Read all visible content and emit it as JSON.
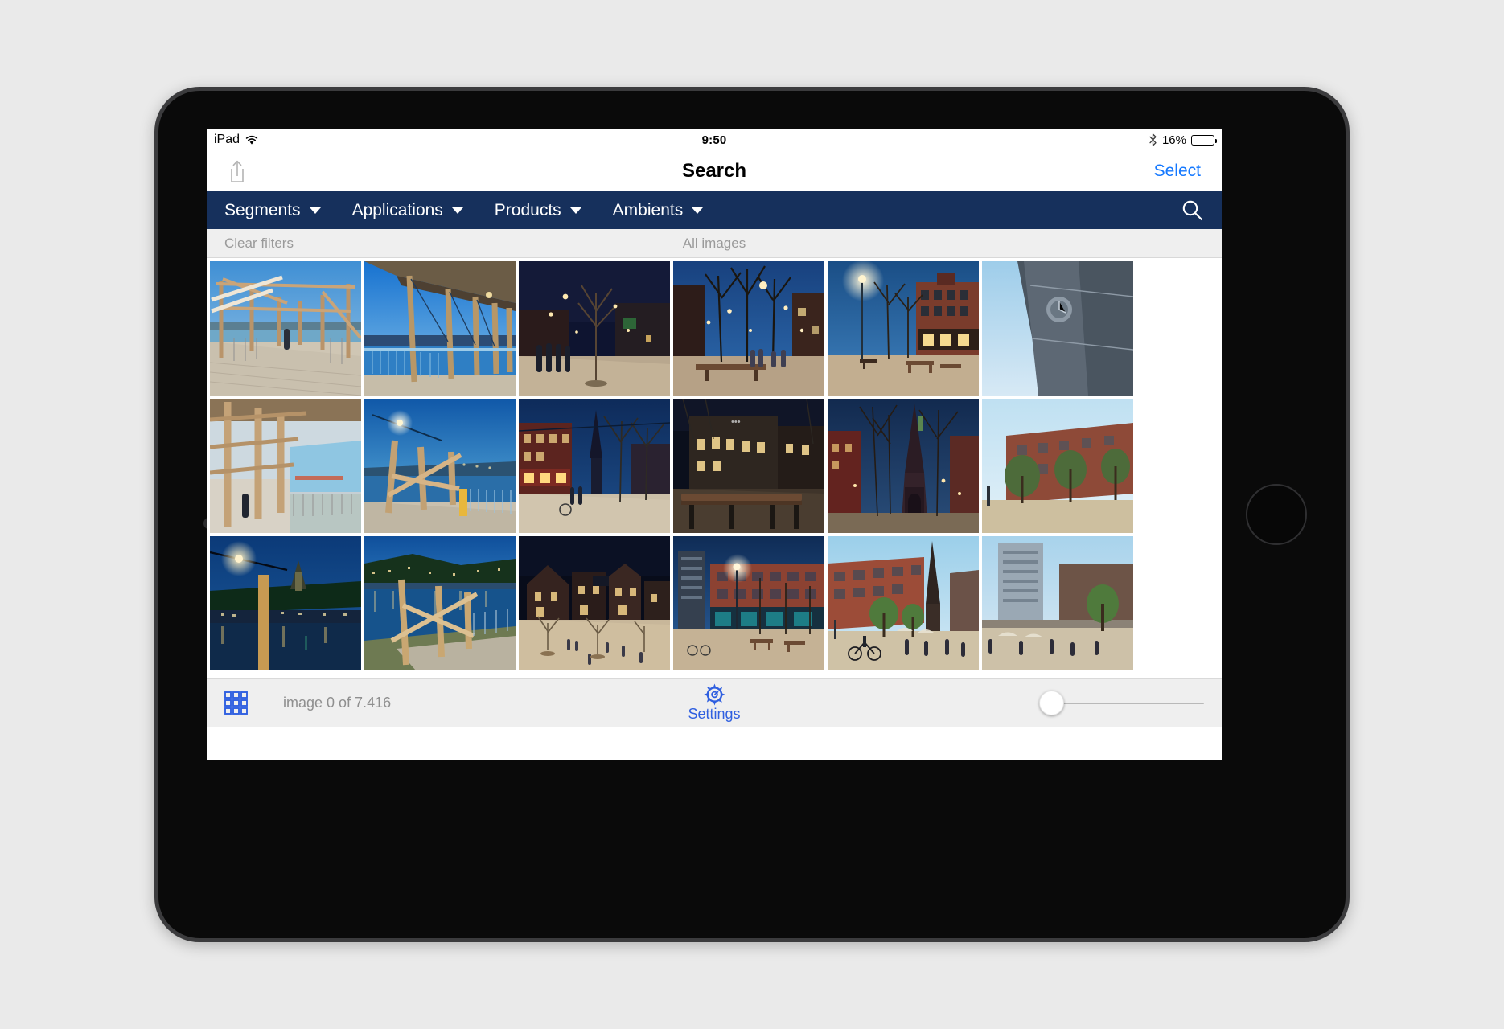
{
  "device": {
    "type": "ipad",
    "orientation": "landscape"
  },
  "status_bar": {
    "carrier_label": "iPad",
    "wifi_icon": "wifi-icon",
    "time": "9:50",
    "bluetooth_icon": "bluetooth-icon",
    "battery_percent_label": "16%",
    "battery_level": 16
  },
  "nav_bar": {
    "share_icon": "share-icon",
    "title": "Search",
    "select_label": "Select",
    "accent_color": "#1478ff"
  },
  "filter_bar": {
    "background_color": "#16305c",
    "items": [
      {
        "label": "Segments",
        "caret_icon": "chevron-down-icon"
      },
      {
        "label": "Applications",
        "caret_icon": "chevron-down-icon"
      },
      {
        "label": "Products",
        "caret_icon": "chevron-down-icon"
      },
      {
        "label": "Ambients",
        "caret_icon": "chevron-down-icon"
      }
    ],
    "search_icon": "search-icon"
  },
  "sub_bar": {
    "clear_filters_label": "Clear filters",
    "scope_label": "All images",
    "text_color": "#9a9a9a"
  },
  "gallery": {
    "columns": 6,
    "rows": 3,
    "thumbnails": [
      {
        "id": "r1c1",
        "caption": "Wooden pergola walkway along riverbank, daytime"
      },
      {
        "id": "r1c2",
        "caption": "Riverside canopy with timber columns over blue river"
      },
      {
        "id": "r1c3",
        "caption": "Night street with bare trees and street lamps"
      },
      {
        "id": "r1c4",
        "caption": "Evening square with benches and lit buildings"
      },
      {
        "id": "r1c5",
        "caption": "Plaza at dusk with brick facade and street lamp"
      },
      {
        "id": "r1c6",
        "caption": "Church tower against pale sky"
      },
      {
        "id": "r2c1",
        "caption": "Timber colonnade promenade with pedestrian"
      },
      {
        "id": "r2c2",
        "caption": "Blue hour riverside with wooden railing and lamp"
      },
      {
        "id": "r2c3",
        "caption": "Night boulevard with church spire"
      },
      {
        "id": "r2c4",
        "caption": "Lit historic building and long bench at night"
      },
      {
        "id": "r2c5",
        "caption": "Gothic church spire at twilight with bare trees"
      },
      {
        "id": "r2c6",
        "caption": "Brick building and trees in daylight"
      },
      {
        "id": "r3c1",
        "caption": "River at night with lamp and hilltop basilica"
      },
      {
        "id": "r3c2",
        "caption": "River panorama at blue hour with wooden structure"
      },
      {
        "id": "r3c3",
        "caption": "Night square with historic facades and people"
      },
      {
        "id": "r3c4",
        "caption": "Modern plaza at dusk with tower and shops"
      },
      {
        "id": "r3c5",
        "caption": "Daytime square with cyclist, cafe and spire"
      },
      {
        "id": "r3c6",
        "caption": "Street cafe terrace with high rise"
      }
    ]
  },
  "bottom_bar": {
    "grid_view_icon": "grid-icon",
    "image_count_label": "image 0 of 7.416",
    "settings_icon": "gear-icon",
    "settings_label": "Settings",
    "slider": {
      "value": 0,
      "min": 0,
      "max": 100
    },
    "accent_color": "#2f5fe0"
  }
}
